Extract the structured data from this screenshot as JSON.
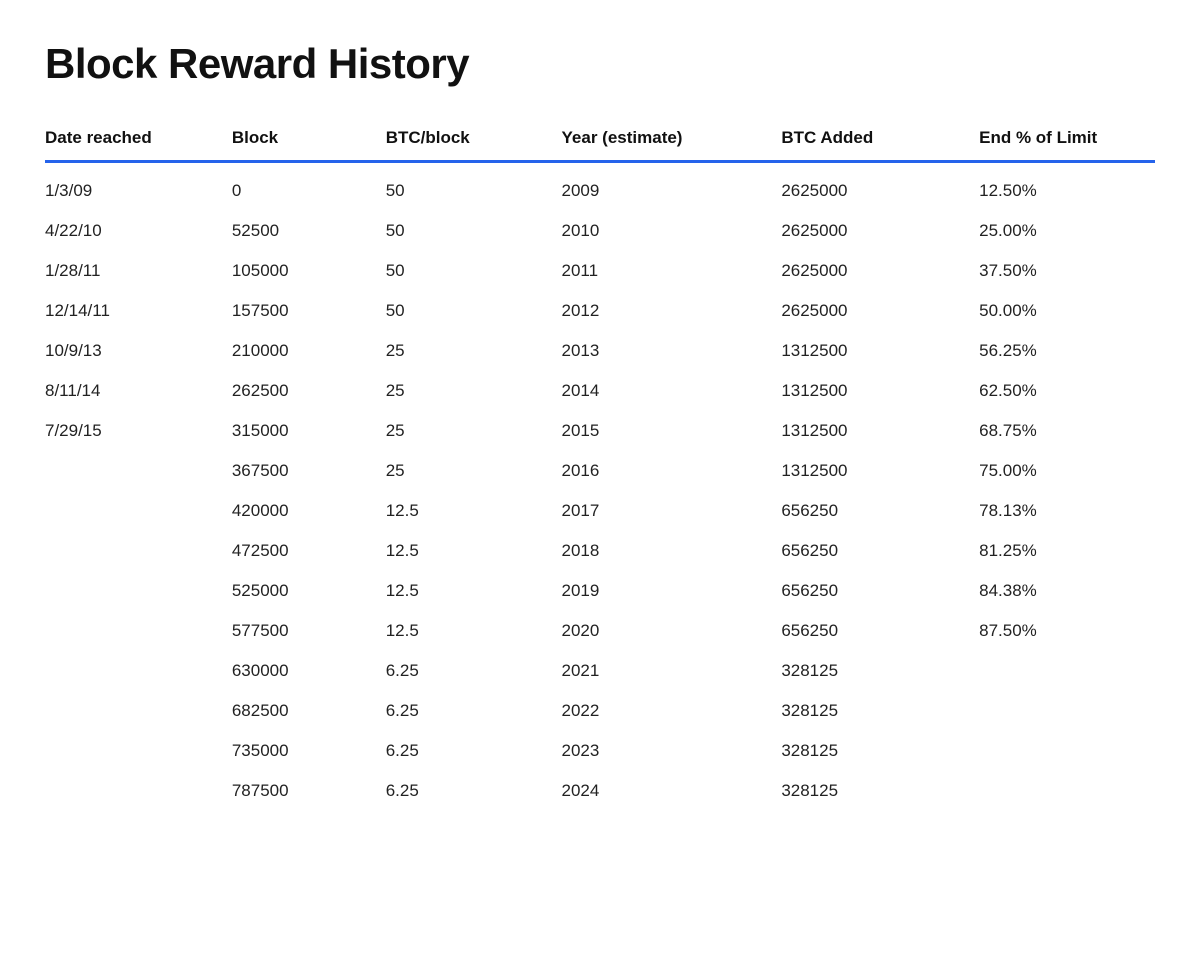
{
  "page": {
    "title": "Block Reward History"
  },
  "table": {
    "headers": {
      "date": "Date reached",
      "block": "Block",
      "btc_per_block": "BTC/block",
      "year": "Year (estimate)",
      "btc_added": "BTC Added",
      "end_pct": "End % of Limit"
    },
    "rows": [
      {
        "date": "1/3/09",
        "block": "0",
        "btc_per_block": "50",
        "year": "2009",
        "btc_added": "2625000",
        "end_pct": "12.50%"
      },
      {
        "date": "4/22/10",
        "block": "52500",
        "btc_per_block": "50",
        "year": "2010",
        "btc_added": "2625000",
        "end_pct": "25.00%"
      },
      {
        "date": "1/28/11",
        "block": "105000",
        "btc_per_block": "50",
        "year": "2011",
        "btc_added": "2625000",
        "end_pct": "37.50%"
      },
      {
        "date": "12/14/11",
        "block": "157500",
        "btc_per_block": "50",
        "year": "2012",
        "btc_added": "2625000",
        "end_pct": "50.00%"
      },
      {
        "date": "10/9/13",
        "block": "210000",
        "btc_per_block": "25",
        "year": "2013",
        "btc_added": "1312500",
        "end_pct": "56.25%"
      },
      {
        "date": "8/11/14",
        "block": "262500",
        "btc_per_block": "25",
        "year": "2014",
        "btc_added": "1312500",
        "end_pct": "62.50%"
      },
      {
        "date": "7/29/15",
        "block": "315000",
        "btc_per_block": "25",
        "year": "2015",
        "btc_added": "1312500",
        "end_pct": "68.75%"
      },
      {
        "date": "",
        "block": "367500",
        "btc_per_block": "25",
        "year": "2016",
        "btc_added": "1312500",
        "end_pct": "75.00%"
      },
      {
        "date": "",
        "block": "420000",
        "btc_per_block": "12.5",
        "year": "2017",
        "btc_added": "656250",
        "end_pct": "78.13%"
      },
      {
        "date": "",
        "block": "472500",
        "btc_per_block": "12.5",
        "year": "2018",
        "btc_added": "656250",
        "end_pct": "81.25%"
      },
      {
        "date": "",
        "block": "525000",
        "btc_per_block": "12.5",
        "year": "2019",
        "btc_added": "656250",
        "end_pct": "84.38%"
      },
      {
        "date": "",
        "block": "577500",
        "btc_per_block": "12.5",
        "year": "2020",
        "btc_added": "656250",
        "end_pct": "87.50%"
      },
      {
        "date": "",
        "block": "630000",
        "btc_per_block": "6.25",
        "year": "2021",
        "btc_added": "328125",
        "end_pct": ""
      },
      {
        "date": "",
        "block": "682500",
        "btc_per_block": "6.25",
        "year": "2022",
        "btc_added": "328125",
        "end_pct": ""
      },
      {
        "date": "",
        "block": "735000",
        "btc_per_block": "6.25",
        "year": "2023",
        "btc_added": "328125",
        "end_pct": ""
      },
      {
        "date": "",
        "block": "787500",
        "btc_per_block": "6.25",
        "year": "2024",
        "btc_added": "328125",
        "end_pct": ""
      }
    ]
  }
}
